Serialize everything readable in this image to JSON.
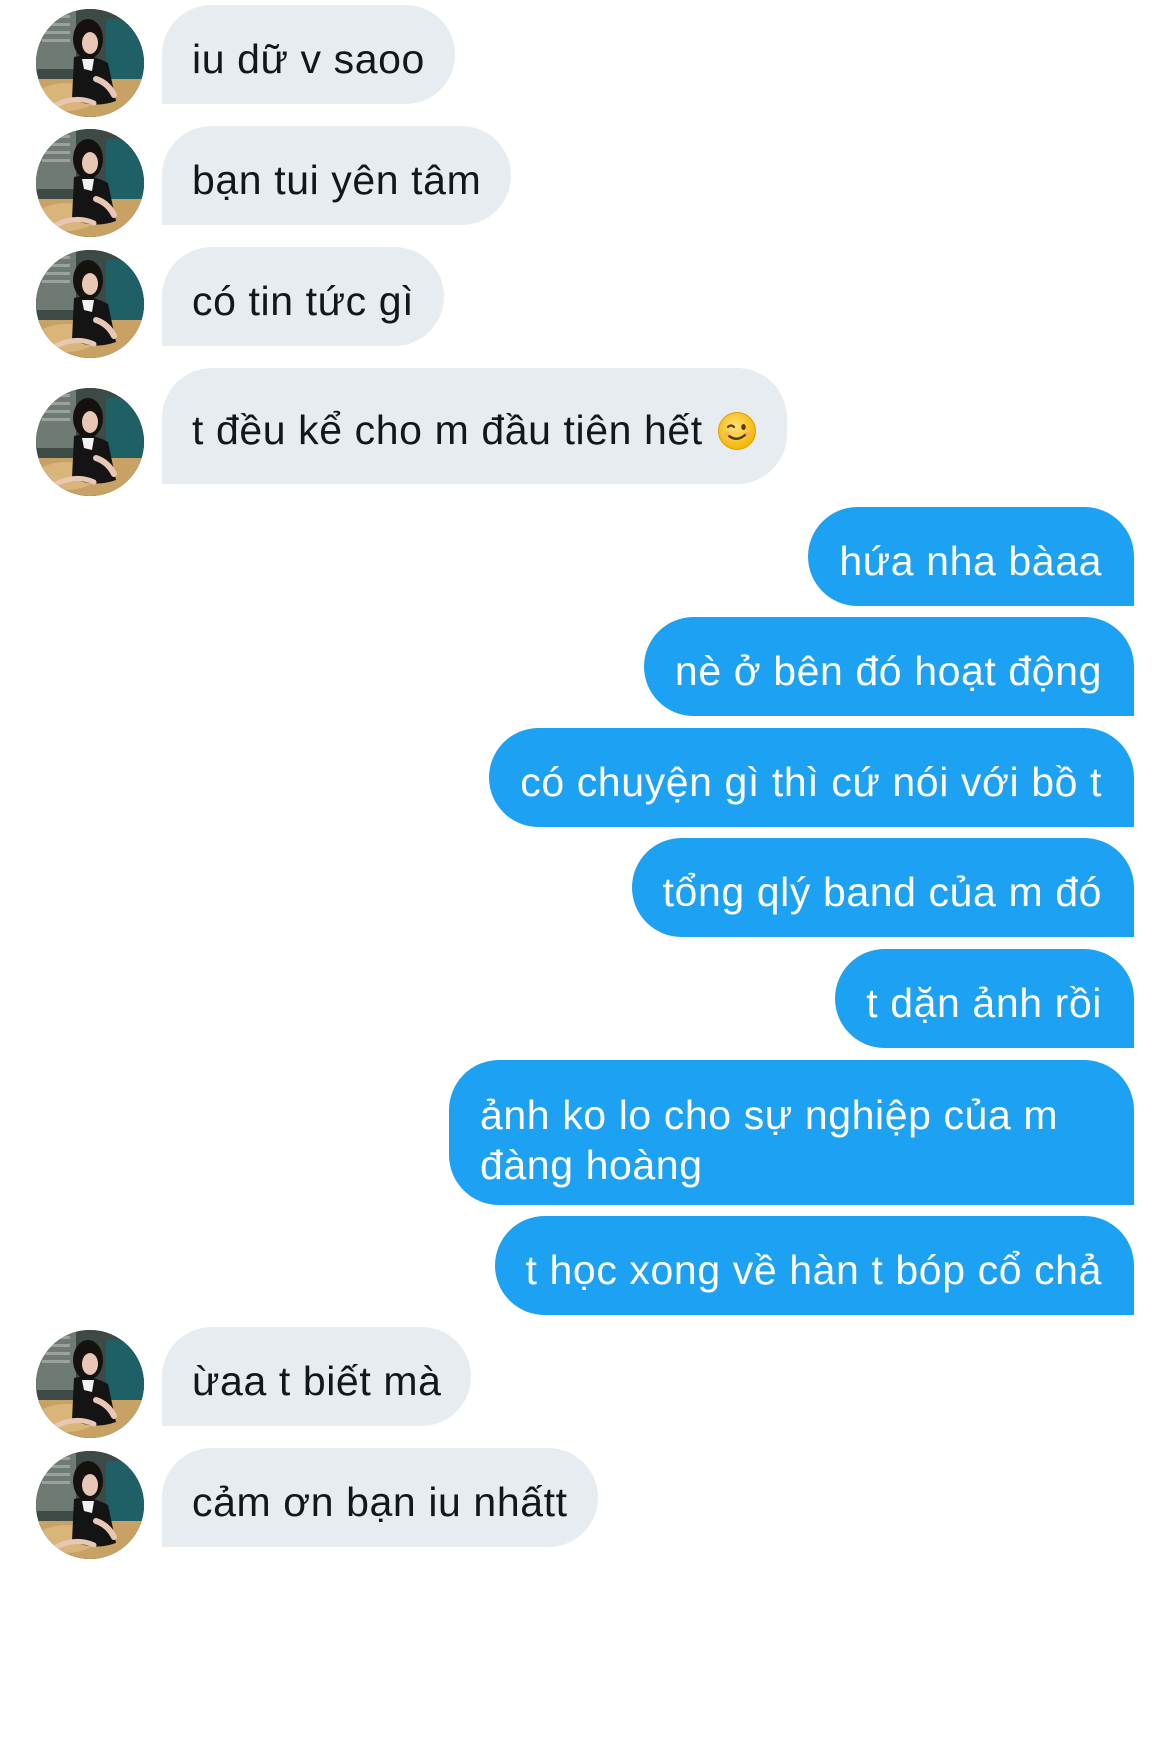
{
  "conversation": {
    "messages": [
      {
        "direction": "incoming",
        "text": "iu dữ v saoo",
        "avatar": "contact-avatar"
      },
      {
        "direction": "incoming",
        "text": "bạn tui yên tâm",
        "avatar": "contact-avatar"
      },
      {
        "direction": "incoming",
        "text": "có tin tức gì",
        "avatar": "contact-avatar"
      },
      {
        "direction": "incoming",
        "text": "t đều kể cho m đầu tiên hết",
        "emoji": "winking-face-emoji",
        "avatar": "contact-avatar"
      },
      {
        "direction": "outgoing",
        "text": "hứa nha bàaa"
      },
      {
        "direction": "outgoing",
        "text": "nè ở bên đó hoạt động"
      },
      {
        "direction": "outgoing",
        "text": "có chuyện gì thì cứ nói với bồ t"
      },
      {
        "direction": "outgoing",
        "text": "tổng qlý band của m đó"
      },
      {
        "direction": "outgoing",
        "text": "t dặn ảnh rồi"
      },
      {
        "direction": "outgoing",
        "text": "ảnh ko lo cho sự nghiệp của m đàng hoàng"
      },
      {
        "direction": "outgoing",
        "text": "t học xong về hàn t bóp cổ chả"
      },
      {
        "direction": "incoming",
        "text": "ừaa t biết mà",
        "avatar": "contact-avatar"
      },
      {
        "direction": "incoming",
        "text": "cảm ơn bạn iu nhấtt",
        "avatar": "contact-avatar"
      }
    ]
  },
  "colors": {
    "incoming_bubble": "#e6ecf0",
    "incoming_text": "#14171a",
    "outgoing_bubble": "#1da1f2",
    "outgoing_text": "#ffffff",
    "background": "#ffffff"
  }
}
